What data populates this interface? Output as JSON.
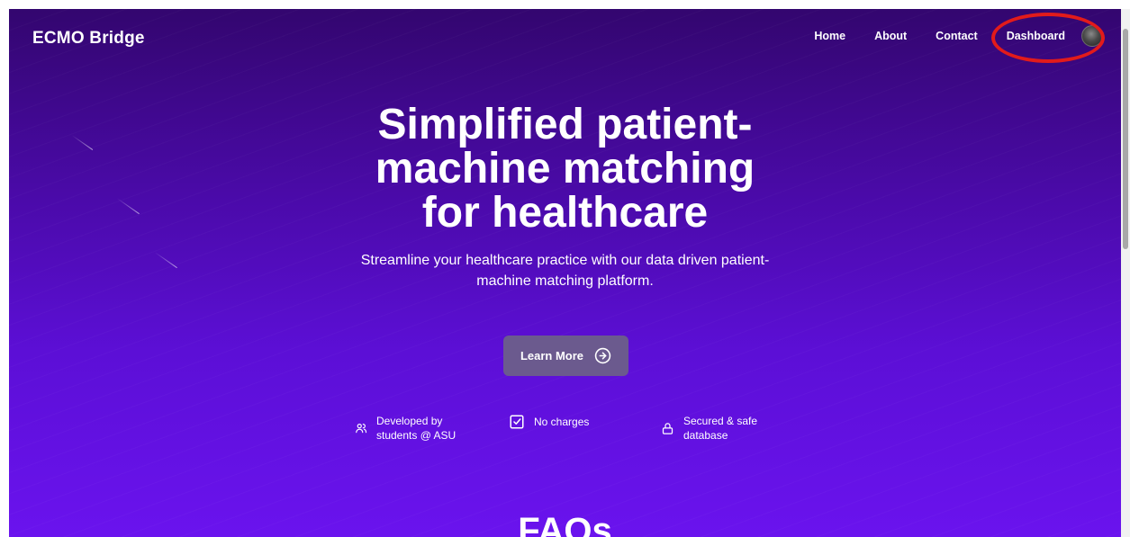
{
  "brand": {
    "name": "ECMO Bridge"
  },
  "nav": {
    "links": [
      {
        "label": "Home"
      },
      {
        "label": "About"
      },
      {
        "label": "Contact"
      },
      {
        "label": "Dashboard"
      }
    ],
    "avatar_icon": "user-avatar-icon"
  },
  "hero": {
    "title_lines": [
      "Simplified patient-",
      "machine matching",
      "for healthcare"
    ],
    "subtitle_lines": [
      "Streamline your healthcare practice with our data driven patient-",
      "machine matching platform."
    ],
    "cta_label": "Learn More",
    "cta_icon": "arrow-right-circle-icon"
  },
  "features": [
    {
      "icon": "users-icon",
      "lines": [
        "Developed by",
        "students @ ASU"
      ]
    },
    {
      "icon": "check-square-icon",
      "lines": [
        "No charges"
      ]
    },
    {
      "icon": "lock-icon",
      "lines": [
        "Secured & safe",
        "database"
      ]
    }
  ],
  "faq": {
    "title": "FAQs"
  },
  "colors": {
    "bg_top": "#33066f",
    "bg_bottom": "#6a13ee",
    "cta_bg": "#6b5a8e",
    "highlight": "#e21b1b",
    "text": "#ffffff"
  }
}
